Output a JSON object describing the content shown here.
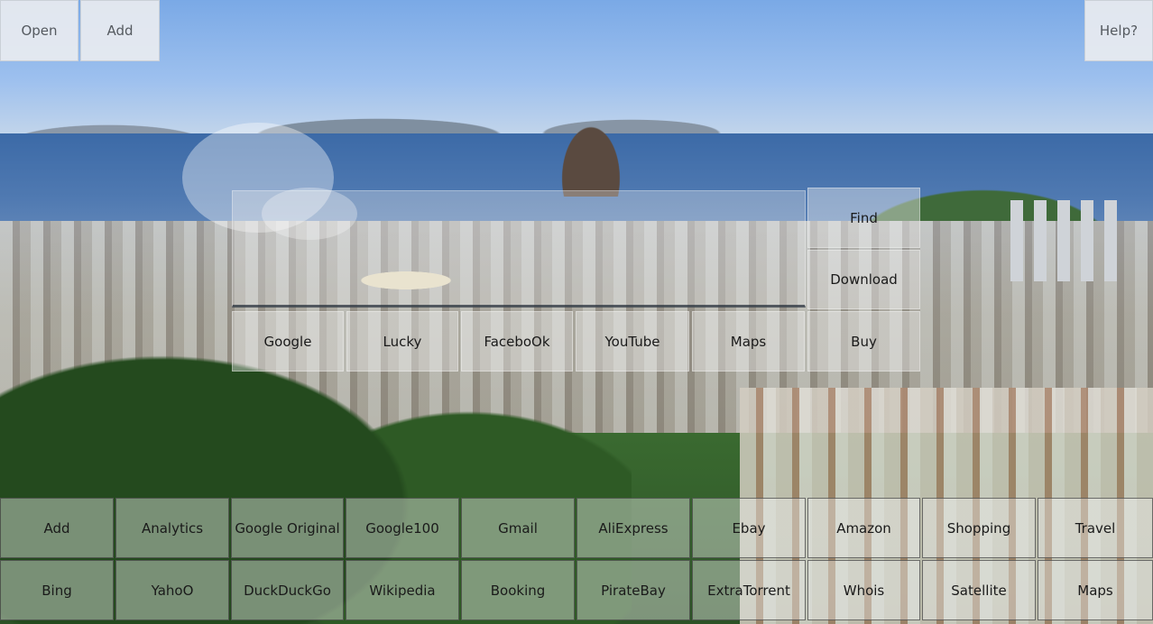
{
  "top_bar": {
    "open_label": "Open",
    "add_label": "Add",
    "help_label": "Help?"
  },
  "search": {
    "value": "",
    "placeholder": ""
  },
  "actions": {
    "find_label": "Find",
    "download_label": "Download",
    "buy_label": "Buy"
  },
  "engines": [
    {
      "label": "Google"
    },
    {
      "label": "Lucky"
    },
    {
      "label": "FaceboOk"
    },
    {
      "label": "YouTube"
    },
    {
      "label": "Maps"
    }
  ],
  "bookmarks": {
    "row1": [
      {
        "label": "Add"
      },
      {
        "label": "Analytics"
      },
      {
        "label": "Google Original"
      },
      {
        "label": "Google100"
      },
      {
        "label": "Gmail"
      },
      {
        "label": "AliExpress"
      },
      {
        "label": "Ebay"
      },
      {
        "label": "Amazon"
      },
      {
        "label": "Shopping"
      },
      {
        "label": "Travel"
      }
    ],
    "row2": [
      {
        "label": "Bing"
      },
      {
        "label": "YahoO"
      },
      {
        "label": "DuckDuckGo"
      },
      {
        "label": "Wikipedia"
      },
      {
        "label": "Booking"
      },
      {
        "label": "PirateBay"
      },
      {
        "label": "ExtraTorrent"
      },
      {
        "label": "Whois"
      },
      {
        "label": "Satellite"
      },
      {
        "label": "Maps"
      }
    ]
  }
}
